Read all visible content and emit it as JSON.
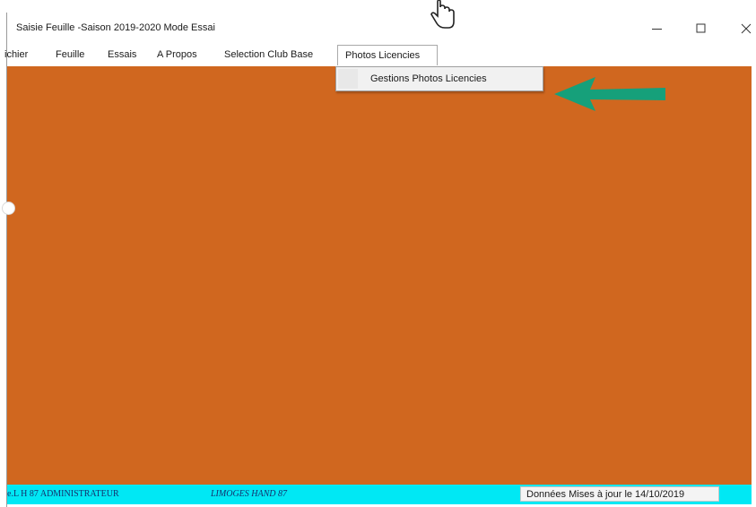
{
  "window": {
    "title": "Saisie Feuille -Saison 2019-2020 Mode Essai"
  },
  "menubar": {
    "items": [
      {
        "label": "ichier"
      },
      {
        "label": "Feuille"
      },
      {
        "label": "Essais"
      },
      {
        "label": "A Propos"
      },
      {
        "label": "Selection Club Base"
      },
      {
        "label": "Photos Licencies"
      }
    ]
  },
  "dropdown": {
    "items": [
      {
        "label": "Gestions Photos Licencies"
      }
    ]
  },
  "statusbar": {
    "left_text": "e.L H 87 ADMINISTRATEUR",
    "middle_text": "LIMOGES HAND 87",
    "right_text": "Données Mises à jour le 14/10/2019"
  },
  "colors": {
    "client_background": "#d0671f",
    "statusbar_background": "#00e8f4",
    "arrow": "#16a07a"
  },
  "icons": {
    "minimize": "minimize-icon",
    "maximize": "maximize-icon",
    "close": "close-icon",
    "cursor": "hand-pointer-icon",
    "annotation": "annotation-arrow-icon"
  }
}
